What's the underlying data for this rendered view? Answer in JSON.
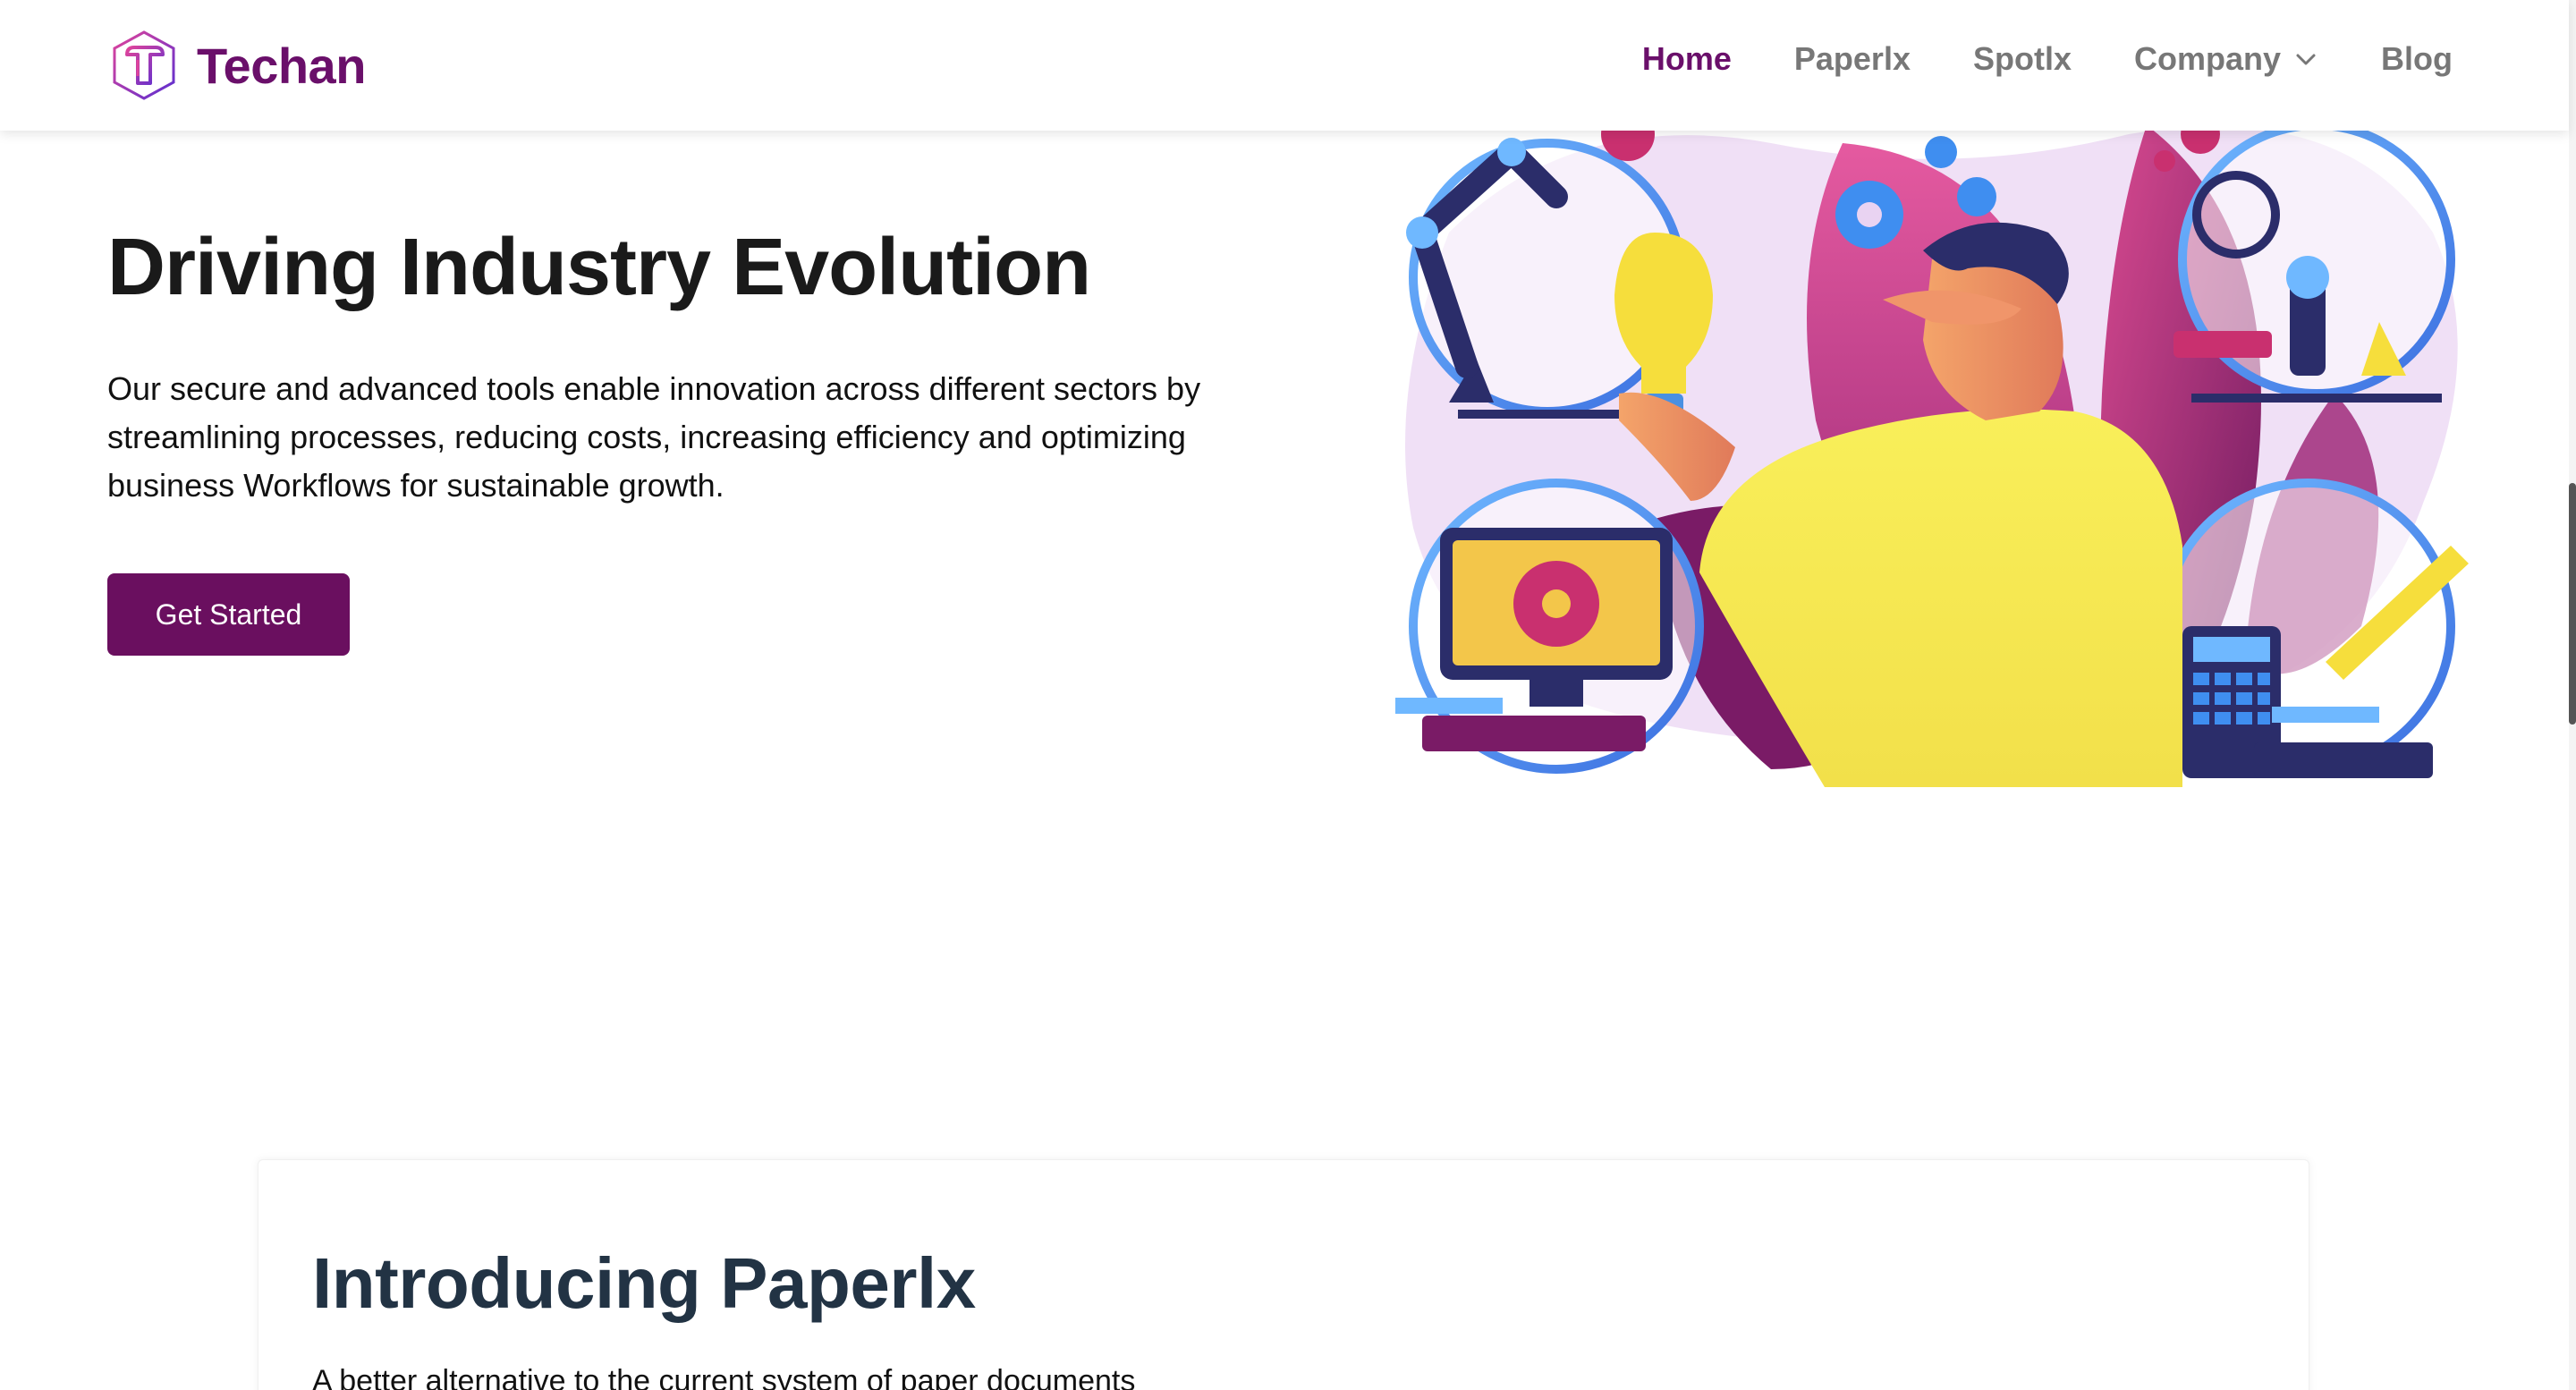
{
  "brand": {
    "name": "Techan",
    "icon": "techan-logo-icon",
    "color": "#6a0f6a"
  },
  "nav": {
    "items": [
      {
        "label": "Home",
        "active": true
      },
      {
        "label": "Paperlx",
        "active": false
      },
      {
        "label": "Spotlx",
        "active": false
      },
      {
        "label": "Company",
        "active": false,
        "icon": "chevron-down-icon"
      },
      {
        "label": "Blog",
        "active": false
      }
    ]
  },
  "hero": {
    "title": "Driving Industry Evolution",
    "description": "Our secure and advanced tools enable innovation across different sectors by streamlining processes, reducing costs, increasing efficiency and optimizing business Workflows for sustainable growth.",
    "cta_label": "Get Started",
    "illustration": "industry-innovation-illustration"
  },
  "section": {
    "title": "Introducing Paperlx",
    "subtitle": "A better alternative to the current system of paper documents"
  },
  "colors": {
    "primary": "#6a0f5f",
    "accent_pink": "#d9428f",
    "accent_yellow": "#f6ee5a",
    "accent_blue": "#4a90e2"
  }
}
